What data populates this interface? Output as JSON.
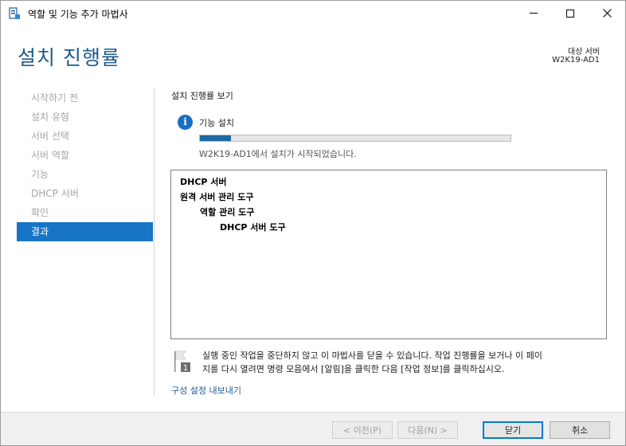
{
  "window": {
    "title": "역할 및 기능 추가 마법사"
  },
  "header": {
    "page_title": "설치 진행률",
    "destination_label": "대상 서버",
    "destination_server": "W2K19-AD1"
  },
  "nav": {
    "items": [
      {
        "label": "시작하기 전",
        "active": false
      },
      {
        "label": "설치 유형",
        "active": false
      },
      {
        "label": "서버 선택",
        "active": false
      },
      {
        "label": "서버 역할",
        "active": false
      },
      {
        "label": "기능",
        "active": false
      },
      {
        "label": "DHCP 서버",
        "active": false
      },
      {
        "label": "확인",
        "active": false
      },
      {
        "label": "결과",
        "active": true
      }
    ]
  },
  "content": {
    "section_heading": "설치 진행률 보기",
    "feature_label": "기능 설치",
    "progress_fraction": 0.1,
    "status_text": "W2K19-AD1에서 설치가 시작되었습니다.",
    "results": [
      {
        "text": "DHCP 서버",
        "level": 0
      },
      {
        "text": "원격 서버 관리 도구",
        "level": 0
      },
      {
        "text": "역할 관리 도구",
        "level": 1
      },
      {
        "text": "DHCP 서버 도구",
        "level": 2
      }
    ],
    "note_line1": "실행 중인 작업을 중단하지 않고 이 마법사를 닫을 수 있습니다. 작업 진행률을 보거나 이 페이",
    "note_line2": "지를 다시 열려면 명령 모음에서 [알림]을 클릭한 다음 [작업 정보]를 클릭하십시오.",
    "note_badge": "1",
    "export_link": "구성 설정 내보내기"
  },
  "footer": {
    "prev_label": "< 이전(P)",
    "next_label": "다음(N) >",
    "close_label": "닫기",
    "cancel_label": "취소"
  },
  "colors": {
    "accent": "#1874c6",
    "title": "#1e5a8a",
    "progress": "#1e6aa5",
    "link": "#1c5e99"
  }
}
